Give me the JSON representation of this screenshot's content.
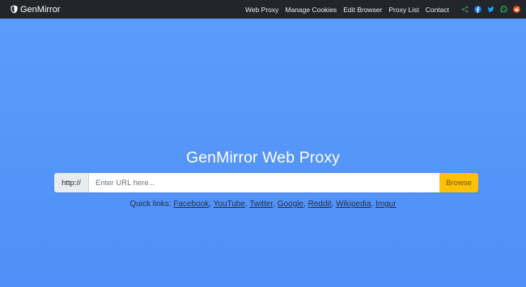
{
  "navbar": {
    "brand": "GenMirror",
    "links": [
      "Web Proxy",
      "Manage Cookies",
      "Edit Browser",
      "Proxy List",
      "Contact"
    ],
    "social": [
      {
        "name": "share-icon",
        "color": "#3d8b5a"
      },
      {
        "name": "facebook-icon",
        "color": "#1877f2"
      },
      {
        "name": "twitter-icon",
        "color": "#1da1f2"
      },
      {
        "name": "whatsapp-icon",
        "color": "#25d366"
      },
      {
        "name": "reddit-icon",
        "color": "#ff4500"
      }
    ]
  },
  "main": {
    "title": "GenMirror Web Proxy",
    "prefix": "http://",
    "placeholder": "Enter URL here...",
    "button": "Browse",
    "quick_label": "Quick links:",
    "quick_links": [
      "Facebook",
      "YouTube",
      "Twitter",
      "Google",
      "Reddit",
      "Wikipedia",
      "Imgur"
    ]
  },
  "colors": {
    "background": "#5497f8",
    "navbar": "#222529",
    "button": "#ffc107"
  }
}
